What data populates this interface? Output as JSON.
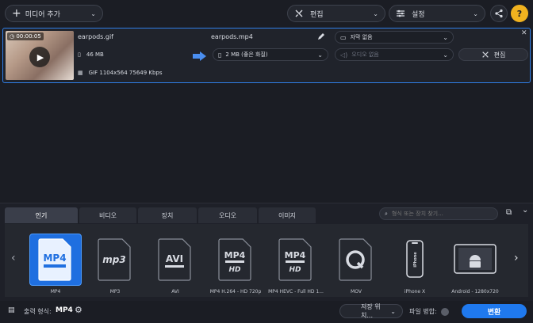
{
  "toolbar": {
    "add_media_label": "미디어 추가",
    "edit_label": "편집",
    "settings_label": "설정"
  },
  "file": {
    "thumb_time": "00:00:05",
    "src_name": "earpods.gif",
    "src_size": "46 MB",
    "src_info": "GIF 1104x564 75649 Kbps",
    "out_name": "earpods.mp4",
    "out_size": "2 MB (좋은 화질)",
    "subtitle": "자막 없음",
    "audio": "오디오 없음",
    "edit_label": "편집"
  },
  "tabs": [
    {
      "label": "인기"
    },
    {
      "label": "비디오"
    },
    {
      "label": "장치"
    },
    {
      "label": "오디오"
    },
    {
      "label": "이미지"
    }
  ],
  "search": {
    "placeholder": "형식 또는 장치 찾기..."
  },
  "formats": [
    {
      "label": "MP4",
      "badge": "MP4"
    },
    {
      "label": "MP3",
      "badge": "mp3"
    },
    {
      "label": "AVI",
      "badge": "AVI"
    },
    {
      "label": "MP4 H.264 - HD 720p",
      "badge": "MP4"
    },
    {
      "label": "MP4 HEVC - Full HD 1...",
      "badge": "MP4"
    },
    {
      "label": "MOV",
      "badge": "Q"
    },
    {
      "label": "iPhone X",
      "badge": "iPhone"
    },
    {
      "label": "Android - 1280x720",
      "badge": "android"
    }
  ],
  "bottom": {
    "output_format_label": "출력 형식:",
    "output_format_value": "MP4",
    "save_to_label": "저장 위치...",
    "merge_label": "파일 병합:",
    "convert_label": "변환"
  },
  "colors": {
    "accent": "#1f79ee",
    "selection": "#2f7ee8"
  }
}
